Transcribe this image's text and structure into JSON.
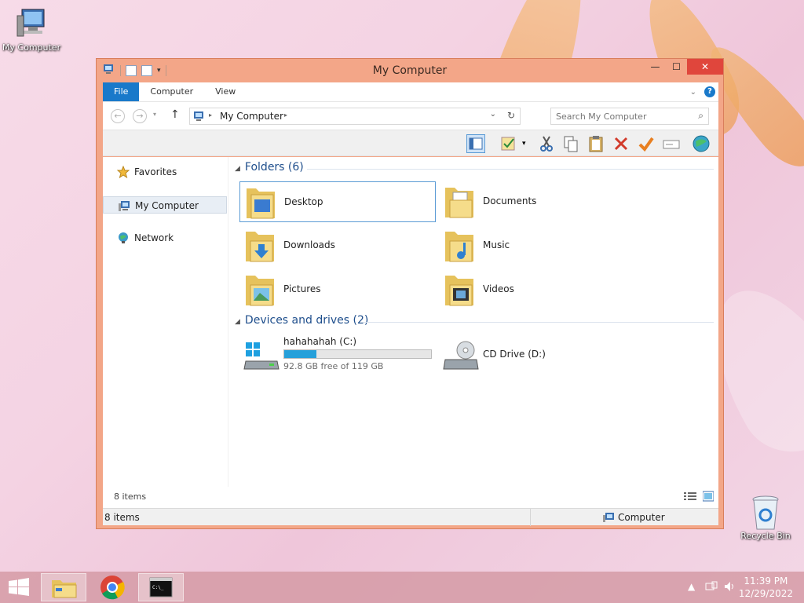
{
  "desktop": {
    "icons": [
      {
        "label": "My Computer"
      },
      {
        "label": "Recycle Bin"
      }
    ]
  },
  "window": {
    "title": "My Computer",
    "buttons": {
      "minimize": "—",
      "maximize": "☐",
      "close": "✕"
    }
  },
  "ribbon": {
    "tabs": [
      "File",
      "Computer",
      "View"
    ]
  },
  "address": {
    "path": "My Computer",
    "search_placeholder": "Search My Computer"
  },
  "nav": {
    "items": [
      "Favorites",
      "My Computer",
      "Network"
    ],
    "selected": "My Computer"
  },
  "folders": {
    "header": "Folders (6)",
    "items": [
      "Desktop",
      "Documents",
      "Downloads",
      "Music",
      "Pictures",
      "Videos"
    ],
    "selected": "Desktop"
  },
  "devices": {
    "header": "Devices and drives (2)",
    "drives": [
      {
        "name": "hahahahah (C:)",
        "free_text": "92.8 GB free of 119 GB",
        "used_fraction": 0.22
      },
      {
        "name": "CD Drive (D:)"
      }
    ]
  },
  "status": {
    "item_count": "8 items",
    "bottom_count": "8 items",
    "location": "Computer"
  },
  "taskbar": {
    "time": "11:39 PM",
    "date": "12/29/2022"
  },
  "colors": {
    "window_frame": "#f3a688",
    "file_tab": "#1979ca",
    "close_button": "#e0463c",
    "drive_bar": "#26a0da",
    "header_text": "#1e4e8c"
  }
}
